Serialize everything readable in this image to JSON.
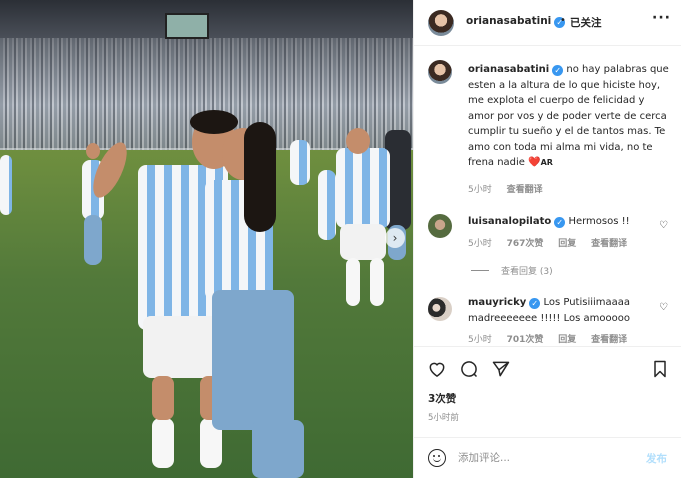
{
  "post": {
    "username": "orianasabatini",
    "follow_status": "已关注",
    "separator": "•",
    "caption": "no hay palabras que esten a la altura de lo que hiciste hoy, me explota el cuerpo de felicidad y amor por vos y de poder verte de cerca cumplir tu sueño y el de tantos mas. Te amo con toda mi alma mi vida, no te frena nadie",
    "caption_emoji": "❤️",
    "caption_suffix": "AR",
    "caption_time": "5小时",
    "caption_translate": "查看翻译",
    "likes": "3次赞",
    "posted_ago": "5小时前"
  },
  "comments": [
    {
      "username": "luisanalopilato",
      "verified": true,
      "text": "Hermosos !!",
      "time": "5小时",
      "likes": "767次赞",
      "reply": "回复",
      "translate": "查看翻译",
      "view_replies": "查看回复 (3)"
    },
    {
      "username": "mauyricky",
      "verified": true,
      "text": "Los Putisiiimaaaa madreeeeeee !!!!! Los amooooo",
      "time": "5小时",
      "likes": "701次赞",
      "reply": "回复",
      "translate": "查看翻译"
    }
  ],
  "composer": {
    "placeholder": "添加评论...",
    "post_label": "发布"
  },
  "icons": {
    "like": "heart-icon",
    "comment": "comment-icon",
    "share": "send-icon",
    "save": "bookmark-icon",
    "more": "more-options-icon",
    "emoji": "emoji-icon",
    "verified": "verified-badge-icon",
    "carousel_next": "chevron-right-icon"
  },
  "colors": {
    "verified": "#3897f0",
    "text": "#262626",
    "muted": "#8e8e8e",
    "heart": "#ed4956",
    "post_button_disabled": "#b2dffc"
  }
}
